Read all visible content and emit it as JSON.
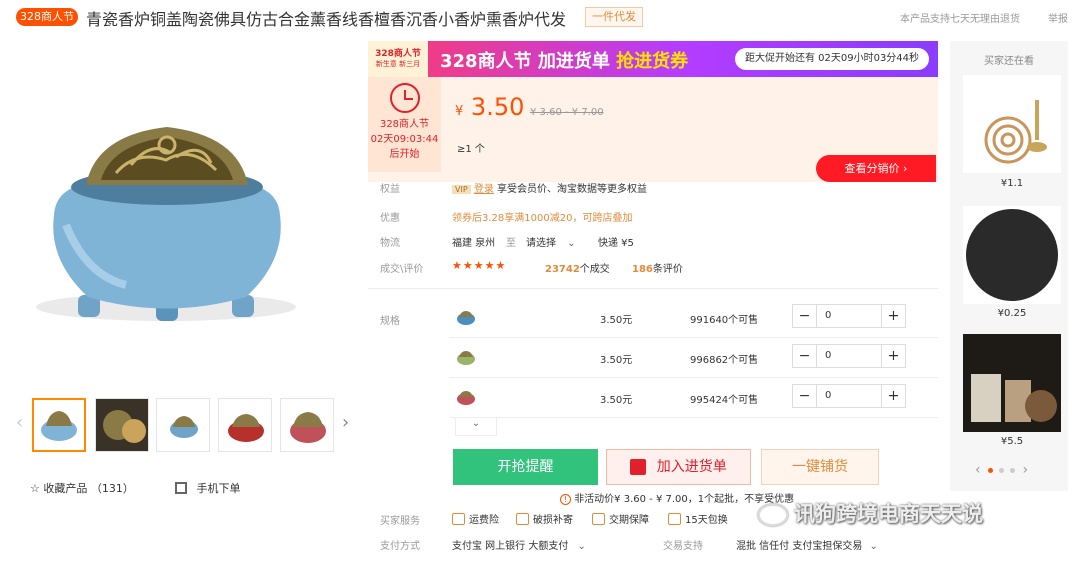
{
  "header": {
    "badge": "328商人节",
    "title": "青瓷香炉铜盖陶瓷佛具仿古合金薰香线香檀香沉香小香炉熏香炉代发",
    "tag": "一件代发",
    "refund_note": "本产品支持七天无理由退货",
    "report": "举报"
  },
  "gallery": {
    "favorites_label": "收藏产品",
    "favorites_count": "（131）",
    "mobile_order": "手机下单"
  },
  "promo": {
    "logo_line1": "328商人节",
    "logo_line2": "新生意 新三月",
    "text_white": "328商人节 加进货单",
    "text_yellow": "抢进货券",
    "countdown": "距大促开始还有 02天09小时03分44秒"
  },
  "price_panel": {
    "timer_label": "328商人节",
    "timer_value": "02天09:03:44",
    "timer_suffix": "后开始",
    "currency": "¥",
    "price": "3.50",
    "old_price": "¥ 3.60 - ¥ 7.00",
    "moq": "≥1 个",
    "view_price_button": "查看分销价"
  },
  "info": {
    "rights_label": "权益",
    "rights_tag": "VIP",
    "rights_link": "登录",
    "rights_text": "享受会员价、淘宝数据等更多权益",
    "coupon_label": "优惠",
    "coupon_text": "领券后3.28享满1000减20，可跨店叠加",
    "logistics_label": "物流",
    "origin": "福建 泉州",
    "to": "至",
    "select": "请选择",
    "express": "快递 ¥5",
    "deals_label": "成交\\评价",
    "stars": "★★★★★",
    "deals_count": "23742",
    "deals_suffix": "个成交",
    "reviews_count": "186",
    "reviews_suffix": "条评价"
  },
  "spec": {
    "label": "规格",
    "rows": [
      {
        "price": "3.50元",
        "stock": "991640个可售",
        "qty": "0",
        "color": "#4a8fbf"
      },
      {
        "price": "3.50元",
        "stock": "996862个可售",
        "qty": "0",
        "color": "#98b36a"
      },
      {
        "price": "3.50元",
        "stock": "995424个可售",
        "qty": "0",
        "color": "#c0505a"
      }
    ]
  },
  "actions": {
    "buy_now": "开抢提醒",
    "add_cart": "加入进货单",
    "one_click": "一键铺货",
    "activity_note": "非活动价¥ 3.60 - ¥ 7.00，1个起批，不享受优惠"
  },
  "services": {
    "label": "买家服务",
    "items": [
      "运费险",
      "破损补寄",
      "交期保障",
      "15天包换"
    ]
  },
  "payment": {
    "label": "支付方式",
    "methods": "支付宝  网上银行  大额支付",
    "trade_label": "交易支持",
    "trade_methods": "混批  信任付  支付宝担保交易"
  },
  "rail": {
    "title": "买家还在看",
    "items": [
      {
        "price": "¥1.1"
      },
      {
        "price": "¥0.25"
      },
      {
        "price": "¥5.5"
      }
    ]
  },
  "watermark": "讯狗跨境电商天天说"
}
